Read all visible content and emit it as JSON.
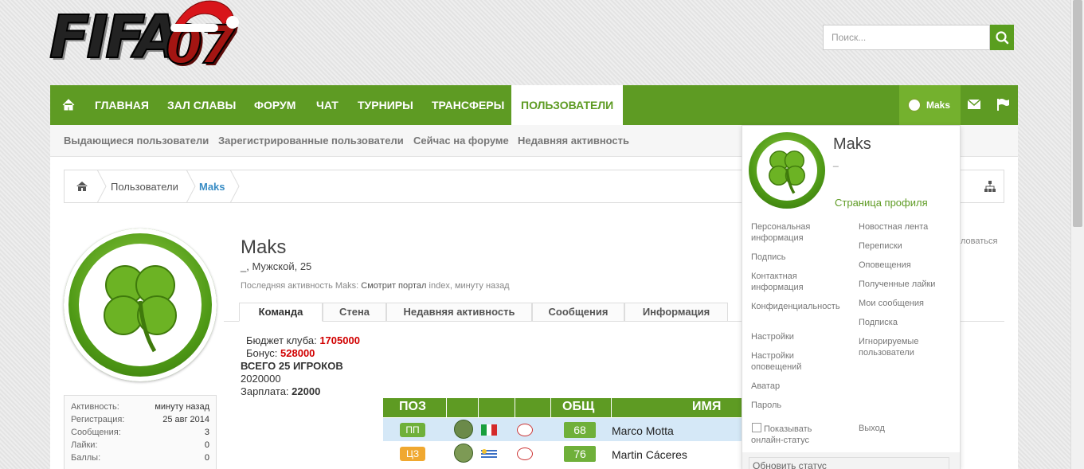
{
  "search": {
    "placeholder": "Поиск..."
  },
  "nav": {
    "items": [
      "ГЛАВНАЯ",
      "ЗАЛ СЛАВЫ",
      "ФОРУМ",
      "ЧАТ",
      "ТУРНИРЫ",
      "ТРАНСФЕРЫ",
      "ПОЛЬЗОВАТЕЛИ"
    ],
    "user": "Maks"
  },
  "subnav": [
    "Выдающиеся пользователи",
    "Зарегистрированные пользователи",
    "Сейчас на форуме",
    "Недавняя активность"
  ],
  "breadcrumb": {
    "parent": "Пользователи",
    "current": "Maks"
  },
  "profile": {
    "name": "Maks",
    "subtitle": "_, Мужской, 25",
    "last_prefix": "Последняя активность Maks:",
    "last_action": "Смотрит портал",
    "last_link": "index",
    "last_time": "минуту назад",
    "ghost_right": "ловаться"
  },
  "tabs": [
    "Команда",
    "Стена",
    "Недавняя активность",
    "Сообщения",
    "Информация"
  ],
  "team": {
    "budget_label": "Бюджет клуба:",
    "budget": "1705000",
    "bonus_label": "Бонус:",
    "bonus": "528000",
    "total": "ВСЕГО 25 ИГРОКОВ",
    "total_value": "2020000",
    "salary_label": "Зарплата:",
    "salary": "22000",
    "headers": {
      "pos": "ПОЗ",
      "ovr": "ОБЩ",
      "name": "ИМЯ"
    },
    "players": [
      {
        "pos": "ПП",
        "pos_color": "#6fb03a",
        "ovr": "68",
        "name": "Marco Motta"
      },
      {
        "pos": "ЦЗ",
        "pos_color": "#f0a830",
        "ovr": "76",
        "name": "Martin Cáceres"
      }
    ]
  },
  "stats": [
    {
      "label": "Активность:",
      "value": "минуту назад"
    },
    {
      "label": "Регистрация:",
      "value": "25 авг 2014"
    },
    {
      "label": "Сообщения:",
      "value": "3"
    },
    {
      "label": "Лайки:",
      "value": "0"
    },
    {
      "label": "Баллы:",
      "value": "0"
    }
  ],
  "dropdown": {
    "name": "Maks",
    "title": "_",
    "profile_link": "Страница профиля",
    "left_links": [
      "Персональная информация",
      "Подпись",
      "Контактная информация",
      "Конфиденциальность",
      "Настройки",
      "Настройки оповещений",
      "Аватар",
      "Пароль"
    ],
    "right_links": [
      "Новостная лента",
      "Переписки",
      "Оповещения",
      "Полученные лайки",
      "Мои сообщения",
      "Подписка",
      "Игнорируемые пользователи"
    ],
    "show_status": "Показывать онлайн-статус",
    "logout": "Выход",
    "status_placeholder": "Обновить статус"
  },
  "colors": {
    "nav": "#5e9b23",
    "nav_user": "#74b12e",
    "accent_red": "#d10000"
  }
}
